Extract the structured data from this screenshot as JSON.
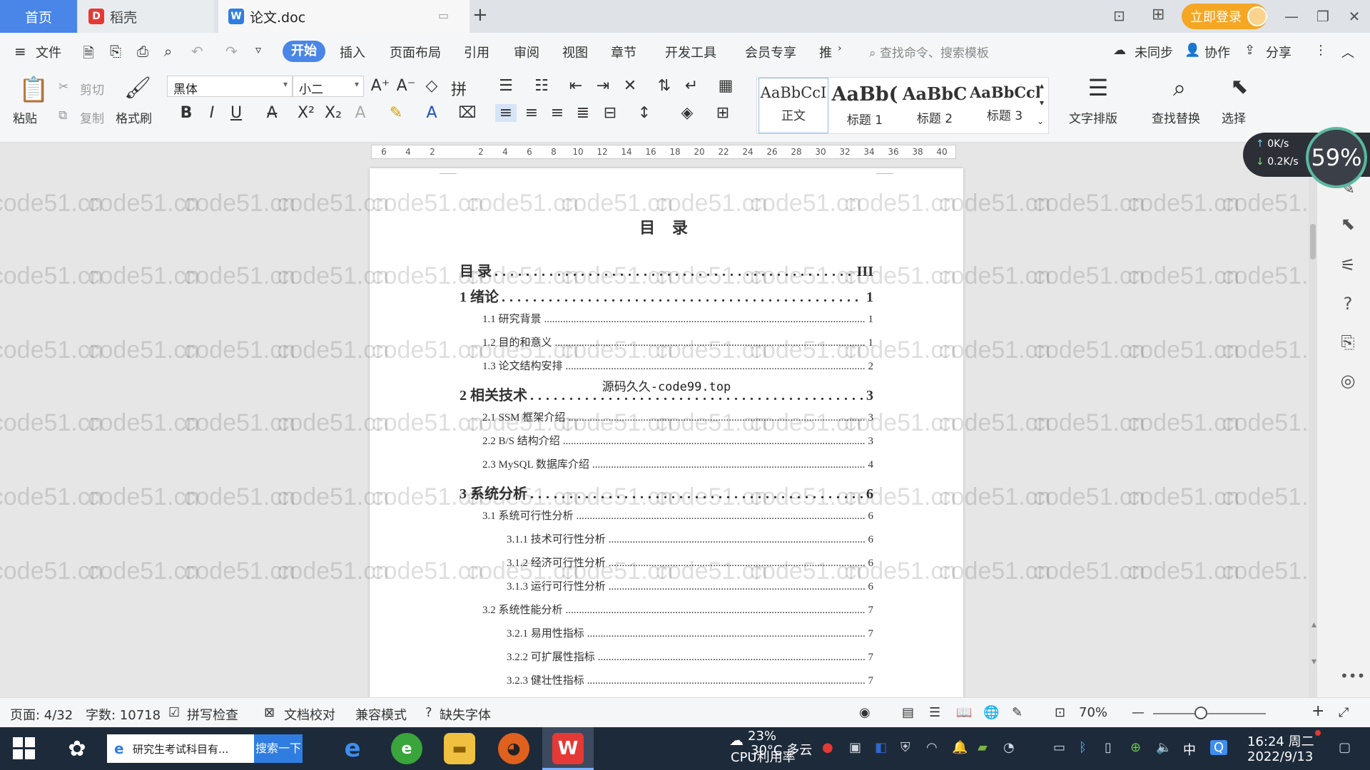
{
  "tabs": {
    "home": "首页",
    "daoke": "稻壳",
    "doc": "论文.doc",
    "new_tab": "+"
  },
  "title_bar": {
    "login": "立即登录"
  },
  "menu": {
    "file": "文件",
    "start": "开始",
    "insert": "插入",
    "page_layout": "页面布局",
    "reference": "引用",
    "review": "审阅",
    "view": "视图",
    "chapter": "章节",
    "dev_tools": "开发工具",
    "member": "会员专享",
    "more": "推",
    "search_placeholder": "查找命令、搜索模板",
    "sync": "未同步",
    "collab": "协作",
    "share": "分享"
  },
  "ribbon": {
    "paste": "粘贴",
    "cut": "剪切",
    "copy": "复制",
    "format_painter": "格式刷",
    "font_name": "黑体",
    "font_size": "小二",
    "styles": [
      {
        "sample": "AaBbCcI",
        "name": "正文"
      },
      {
        "sample": "AaBb(",
        "name": "标题 1"
      },
      {
        "sample": "AaBbC",
        "name": "标题 2"
      },
      {
        "sample": "AaBbCcl",
        "name": "标题 3"
      }
    ],
    "text_layout": "文字排版",
    "find_replace": "查找替换",
    "select": "选择"
  },
  "ruler": {
    "ticks": [
      "6",
      "4",
      "2",
      "",
      "2",
      "4",
      "6",
      "8",
      "10",
      "12",
      "14",
      "16",
      "18",
      "20",
      "22",
      "24",
      "26",
      "28",
      "30",
      "32",
      "34",
      "36",
      "38",
      "40"
    ]
  },
  "document": {
    "heading": "目 录",
    "overlay_text": "源码久久-code99.top",
    "toc": [
      {
        "level": 1,
        "title": "目  录",
        "page": "III"
      },
      {
        "level": 1,
        "title": "1  绪论",
        "page": "1"
      },
      {
        "level": 2,
        "title": "1.1  研究背景",
        "page": "1"
      },
      {
        "level": 2,
        "title": "1.2  目的和意义",
        "page": "1"
      },
      {
        "level": 2,
        "title": "1.3  论文结构安排",
        "page": "2"
      },
      {
        "level": 1,
        "title": "2  相关技术",
        "page": "3"
      },
      {
        "level": 2,
        "title": "2.1 SSM 框架介绍",
        "page": "3"
      },
      {
        "level": 2,
        "title": "2.2 B/S 结构介绍",
        "page": "3"
      },
      {
        "level": 2,
        "title": "2.3 MySQL 数据库介绍",
        "page": "4"
      },
      {
        "level": 1,
        "title": "3  系统分析",
        "page": "6"
      },
      {
        "level": 2,
        "title": "3.1  系统可行性分析",
        "page": "6"
      },
      {
        "level": 3,
        "title": "3.1.1  技术可行性分析",
        "page": "6"
      },
      {
        "level": 3,
        "title": "3.1.2  经济可行性分析",
        "page": "6"
      },
      {
        "level": 3,
        "title": "3.1.3  运行可行性分析",
        "page": "6"
      },
      {
        "level": 2,
        "title": "3.2  系统性能分析",
        "page": "7"
      },
      {
        "level": 3,
        "title": "3.2.1  易用性指标",
        "page": "7"
      },
      {
        "level": 3,
        "title": "3.2.2  可扩展性指标",
        "page": "7"
      },
      {
        "level": 3,
        "title": "3.2.3  健壮性指标",
        "page": "7"
      }
    ]
  },
  "watermark": "code51.cn",
  "net_widget": {
    "up": "0K/s",
    "down": "0.2K/s",
    "cpu": "59%"
  },
  "status": {
    "page": "页面: 4/32",
    "words": "字数: 10718",
    "spell": "拼写检查",
    "proofread": "文档校对",
    "compat": "兼容模式",
    "missing_font": "缺失字体",
    "zoom": "70%"
  },
  "taskbar": {
    "search_text": "研究生考试科目有...",
    "search_button": "搜索一下",
    "weather_temp": "30°C 多云",
    "cpu_pct": "23%",
    "cpu_label": "CPU利用率",
    "lang": "中",
    "time": "16:24 周二",
    "date": "2022/9/13"
  },
  "colors": {
    "accent": "#4a86e8",
    "login_orange": "#f5a623",
    "taskbar": "#1d2a3a"
  }
}
